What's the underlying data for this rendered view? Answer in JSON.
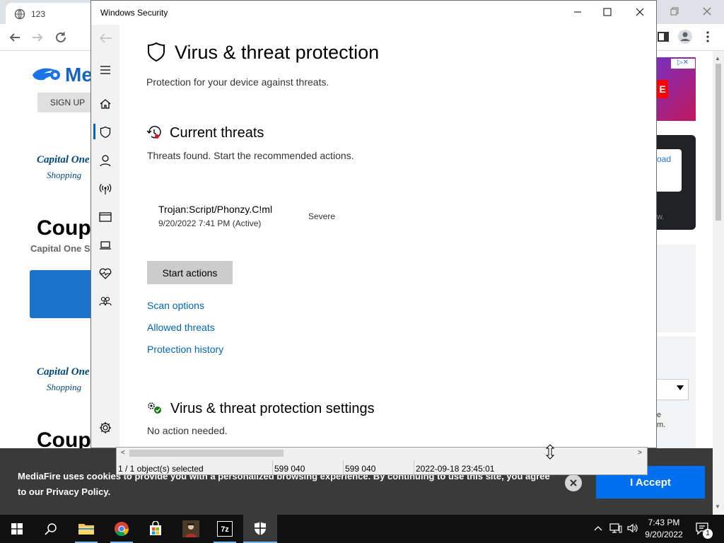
{
  "browser": {
    "tab_title": "123",
    "page": {
      "logo_text": "Me",
      "signup_label": "SIGN UP",
      "capital_one_1": "Capital One",
      "shopping_1": "Shopping",
      "coupon_1": "Coupo",
      "capital_one_sub": "Capital One S",
      "capital_one_2": "Capital One",
      "shopping_2": "Shopping",
      "coupon_2": "Coupo",
      "right_snippet_1": "oad",
      "right_snippet_2": "w.",
      "right_snippet_3": "e",
      "right_snippet_4": "m."
    },
    "cookie": {
      "text_line1": "MediaFire uses cookies to provide you with a personalized browsing experience. By continuing to use this site, you agree",
      "text_line2": "to our Privacy Policy.",
      "accept_label": "I Accept"
    },
    "accent_color": "#1a73e8"
  },
  "windows_security": {
    "window_title": "Windows Security",
    "page_title": "Virus & threat protection",
    "page_subtitle": "Protection for your device against threats.",
    "current_threats": {
      "heading": "Current threats",
      "description": "Threats found. Start the recommended actions.",
      "threat": {
        "name": "Trojan:Script/Phonzy.C!ml",
        "time": "9/20/2022 7:41 PM (Active)",
        "severity": "Severe"
      },
      "start_button": "Start actions",
      "links": [
        "Scan options",
        "Allowed threats",
        "Protection history"
      ]
    },
    "settings": {
      "heading": "Virus & threat protection settings",
      "status": "No action needed."
    },
    "nav_icons": [
      "menu-icon",
      "home-icon",
      "shield-icon",
      "account-icon",
      "firewall-icon",
      "app-browser-icon",
      "device-icon",
      "health-icon",
      "family-icon",
      "settings-gear-icon"
    ]
  },
  "file_manager_status": {
    "selected": "1 / 1 object(s) selected",
    "size": "599 040",
    "packed": "599 040",
    "modified": "2022-09-18 23:45:01"
  },
  "taskbar": {
    "time": "7:43 PM",
    "date": "9/20/2022",
    "notification_count": "1"
  }
}
